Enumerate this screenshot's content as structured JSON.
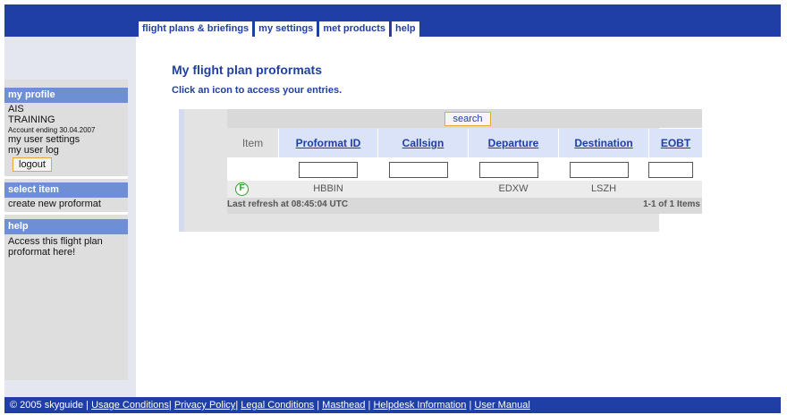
{
  "tabs": [
    {
      "label": "flight plans & briefings"
    },
    {
      "label": "my settings"
    },
    {
      "label": "met products"
    },
    {
      "label": "help"
    }
  ],
  "sidebar": {
    "profile": {
      "heading": "my profile",
      "user_code": "AIS",
      "user_name": "TRAINING",
      "account_note": "Account ending 30.04.2007",
      "settings_link": "my user settings",
      "log_link": "my user log",
      "logout_label": "logout"
    },
    "select_item": {
      "heading": "select item",
      "create_link": "create new proformat"
    },
    "help": {
      "heading": "help",
      "text_line1": "Access this flight plan",
      "text_line2": "proformat here!"
    }
  },
  "main": {
    "title": "My flight plan proformats",
    "instruction": "Click an icon to access your entries.",
    "search_label": "search",
    "columns": {
      "item": "Item",
      "proformat_id": "Proformat ID",
      "callsign": "Callsign",
      "departure": "Departure",
      "destination": "Destination",
      "eobt": "EOBT"
    },
    "rows": [
      {
        "icon": "F",
        "proformat_id": "HBBIN",
        "callsign": "",
        "departure": "EDXW",
        "destination": "LSZH",
        "eobt": ""
      }
    ],
    "refresh_text": "Last refresh at 08:45:04 UTC",
    "count_text": "1-1 of 1 Items"
  },
  "footer": {
    "copyright": "© 2005 skyguide | ",
    "links": [
      "Usage Conditions",
      "Privacy Policy",
      "Legal Conditions",
      "Masthead",
      "Helpdesk Information",
      "User Manual"
    ],
    "sep": [
      "| ",
      "| ",
      " | ",
      " | ",
      " | "
    ]
  },
  "colors": {
    "brand_blue": "#1f3fa6",
    "section_blue": "#6f8fd4",
    "accent_orange": "#e2a93a",
    "icon_green": "#2a9d2a"
  }
}
